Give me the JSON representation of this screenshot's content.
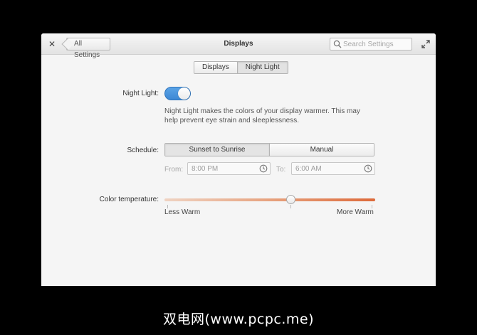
{
  "window": {
    "title": "Displays",
    "back_label": "All Settings",
    "search_placeholder": "Search Settings"
  },
  "tabs": [
    {
      "label": "Displays",
      "active": false
    },
    {
      "label": "Night Light",
      "active": true
    }
  ],
  "night_light": {
    "label": "Night Light:",
    "enabled": true,
    "description": "Night Light makes the colors of your display warmer. This may help prevent eye strain and sleeplessness."
  },
  "schedule": {
    "label": "Schedule:",
    "options": [
      "Sunset to Sunrise",
      "Manual"
    ],
    "selected": "Sunset to Sunrise",
    "from_label": "From:",
    "from_value": "8:00 PM",
    "to_label": "To:",
    "to_value": "6:00 AM"
  },
  "color_temperature": {
    "label": "Color temperature:",
    "min_label": "Less Warm",
    "max_label": "More Warm",
    "value_fraction": 0.6
  },
  "caption": "双电网(www.pcpc.me)",
  "colors": {
    "accent": "#3d88d4",
    "warm_start": "#efd3c2",
    "warm_end": "#dd6a3a"
  }
}
